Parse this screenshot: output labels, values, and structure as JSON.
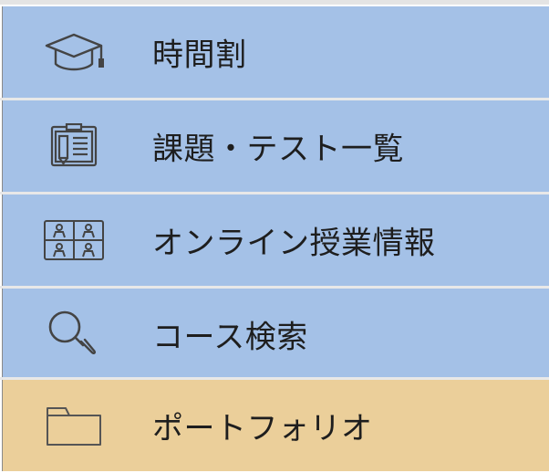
{
  "menu": {
    "items": [
      {
        "label": "時間割",
        "icon": "graduation-cap-icon",
        "bg": "#a4c1e7"
      },
      {
        "label": "課題・テスト一覧",
        "icon": "clipboard-icon",
        "bg": "#a4c1e7"
      },
      {
        "label": "オンライン授業情報",
        "icon": "video-grid-icon",
        "bg": "#a4c1e7"
      },
      {
        "label": "コース検索",
        "icon": "search-icon",
        "bg": "#a4c1e7"
      },
      {
        "label": "ポートフォリオ",
        "icon": "folder-icon",
        "bg": "#ebcf9a"
      }
    ]
  }
}
